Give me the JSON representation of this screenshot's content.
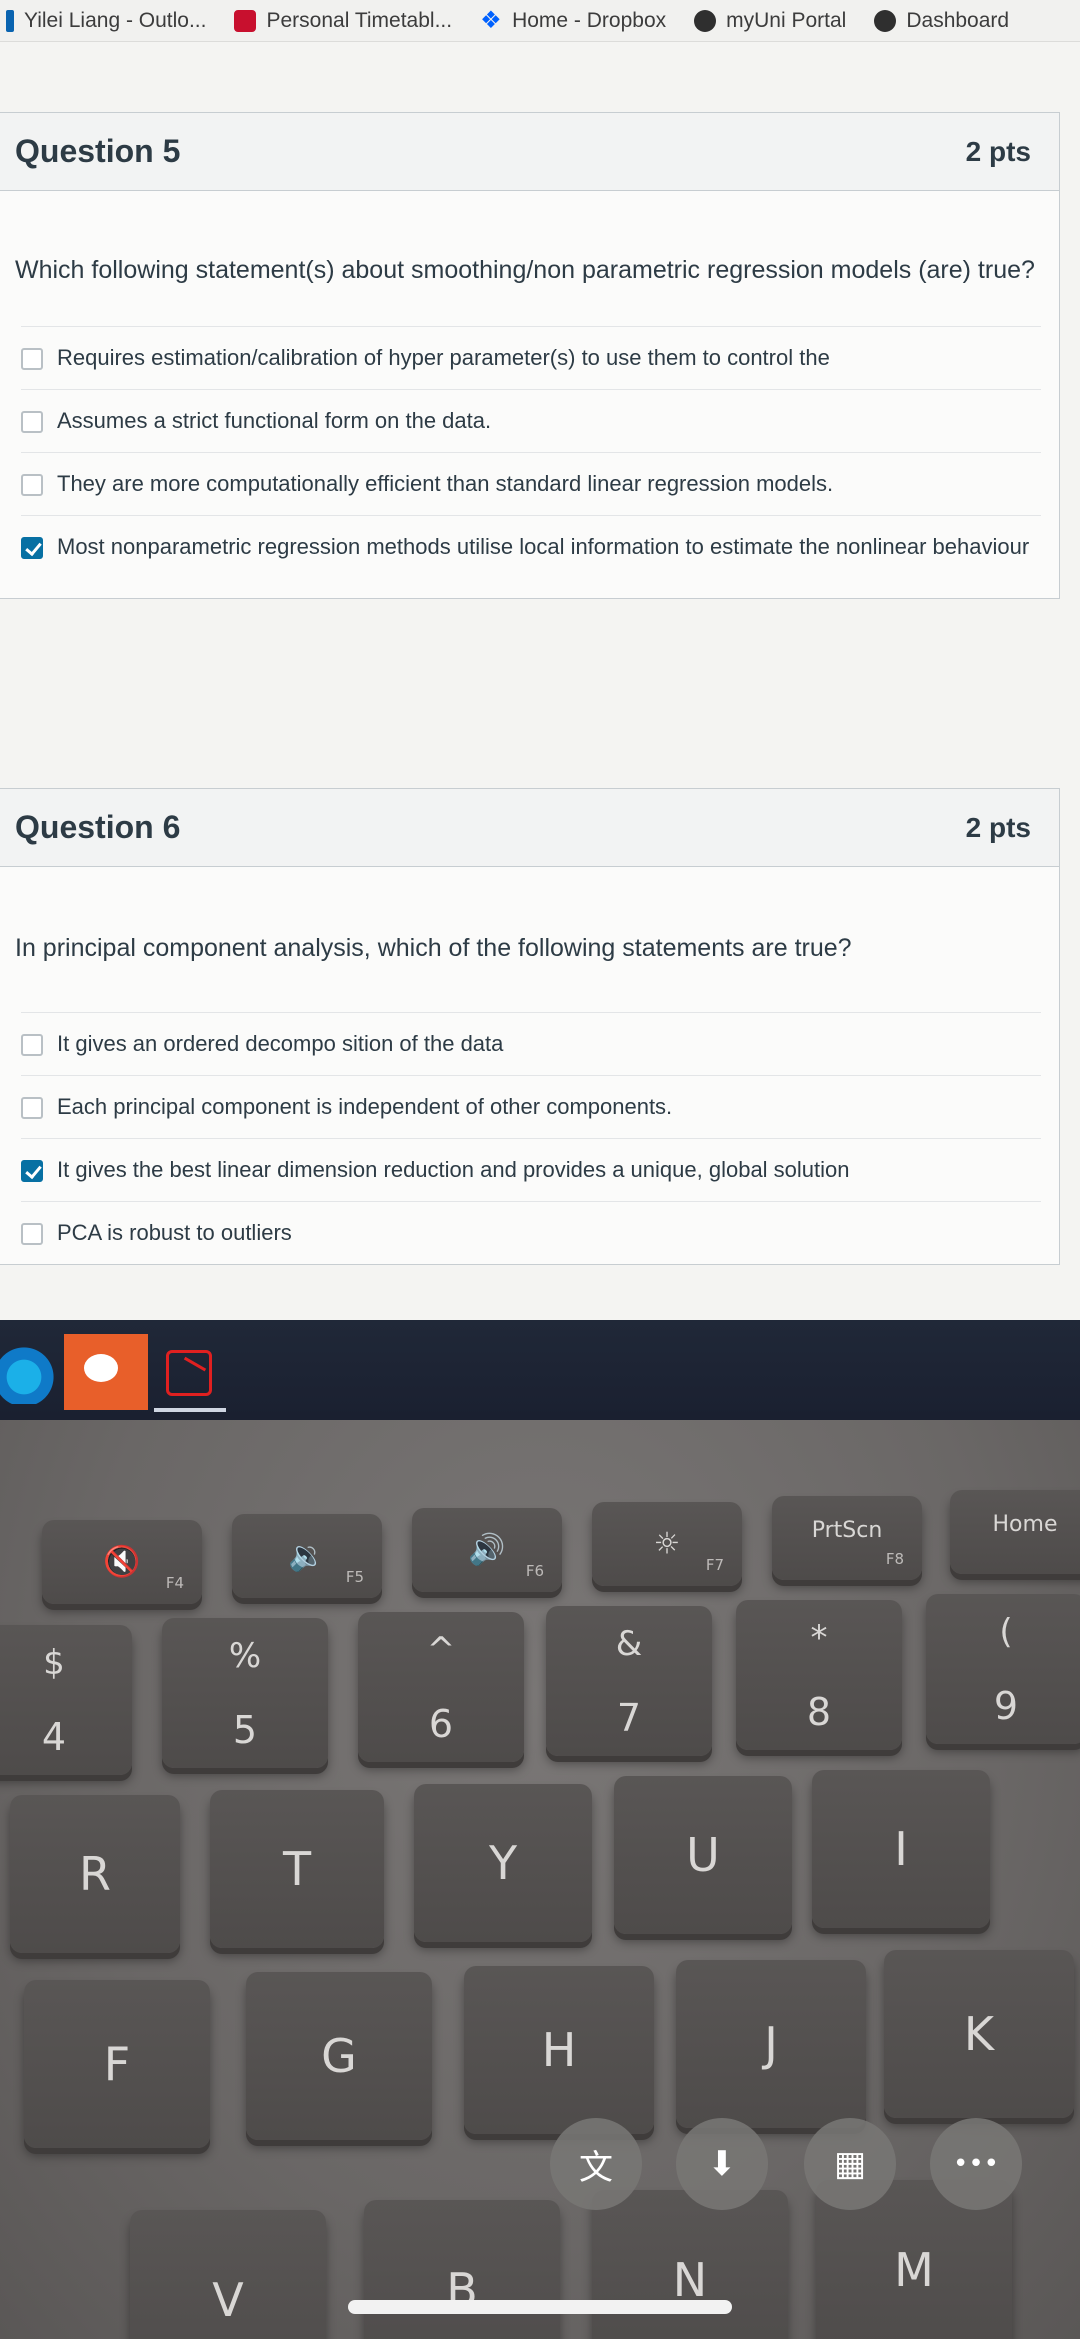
{
  "bookmarks": [
    {
      "label": "Yilei Liang - Outlo...",
      "icon": "outlook-icon"
    },
    {
      "label": "Personal Timetabl...",
      "icon": "university-icon"
    },
    {
      "label": "Home - Dropbox",
      "icon": "dropbox-icon"
    },
    {
      "label": "myUni Portal",
      "icon": "university-icon"
    },
    {
      "label": "Dashboard",
      "icon": "university-icon"
    }
  ],
  "question5": {
    "title": "Question 5",
    "points": "2 pts",
    "text": "Which following statement(s) about smoothing/non parametric regression models (are) true?",
    "answers": [
      {
        "label": "Requires estimation/calibration of hyper parameter(s) to use them to control the",
        "checked": false
      },
      {
        "label": "Assumes a strict functional form on the data.",
        "checked": false
      },
      {
        "label": "They are more computationally efficient than standard linear regression models.",
        "checked": false
      },
      {
        "label": "Most nonparametric regression methods utilise local information to estimate the nonlinear behaviour",
        "checked": true
      }
    ]
  },
  "question6": {
    "title": "Question 6",
    "points": "2 pts",
    "text": "In principal component analysis, which of the following statements are true?",
    "answers": [
      {
        "label": "It gives an ordered decompo sition of the data",
        "checked": false
      },
      {
        "label": "Each principal component is independent of other components.",
        "checked": false
      },
      {
        "label": "It gives the best linear dimension reduction and provides a unique, global solution",
        "checked": true
      },
      {
        "label": "PCA is robust to outliers",
        "checked": false
      }
    ]
  },
  "taskbar": {
    "apps": [
      "edge-icon",
      "wechat-icon",
      "acrobat-icon"
    ]
  },
  "keyboard": {
    "fn_row": [
      {
        "glyph": "🔇",
        "fn": "F4"
      },
      {
        "glyph": "🔉",
        "fn": "F5"
      },
      {
        "glyph": "🔊",
        "fn": "F6"
      },
      {
        "glyph": "☼",
        "fn": "F7"
      },
      {
        "label": "PrtScn",
        "fn": "F8"
      },
      {
        "label": "Home",
        "fn": ""
      }
    ],
    "number_row": [
      {
        "top": "$",
        "bottom": "4"
      },
      {
        "top": "%",
        "bottom": "5"
      },
      {
        "top": "^",
        "bottom": "6"
      },
      {
        "top": "&",
        "bottom": "7"
      },
      {
        "top": "*",
        "bottom": "8"
      },
      {
        "top": "(",
        "bottom": "9"
      }
    ],
    "row_r": [
      "R",
      "T",
      "Y",
      "U",
      "I"
    ],
    "row_f": [
      "F",
      "G",
      "H",
      "J",
      "K"
    ],
    "row_v": [
      "V",
      "B",
      "N",
      "M"
    ]
  },
  "overlay": {
    "buttons": [
      "translate-icon",
      "download-icon",
      "grid-icon",
      "more-icon"
    ],
    "glyphs": [
      "文",
      "⬇",
      "▦",
      "•••"
    ]
  }
}
